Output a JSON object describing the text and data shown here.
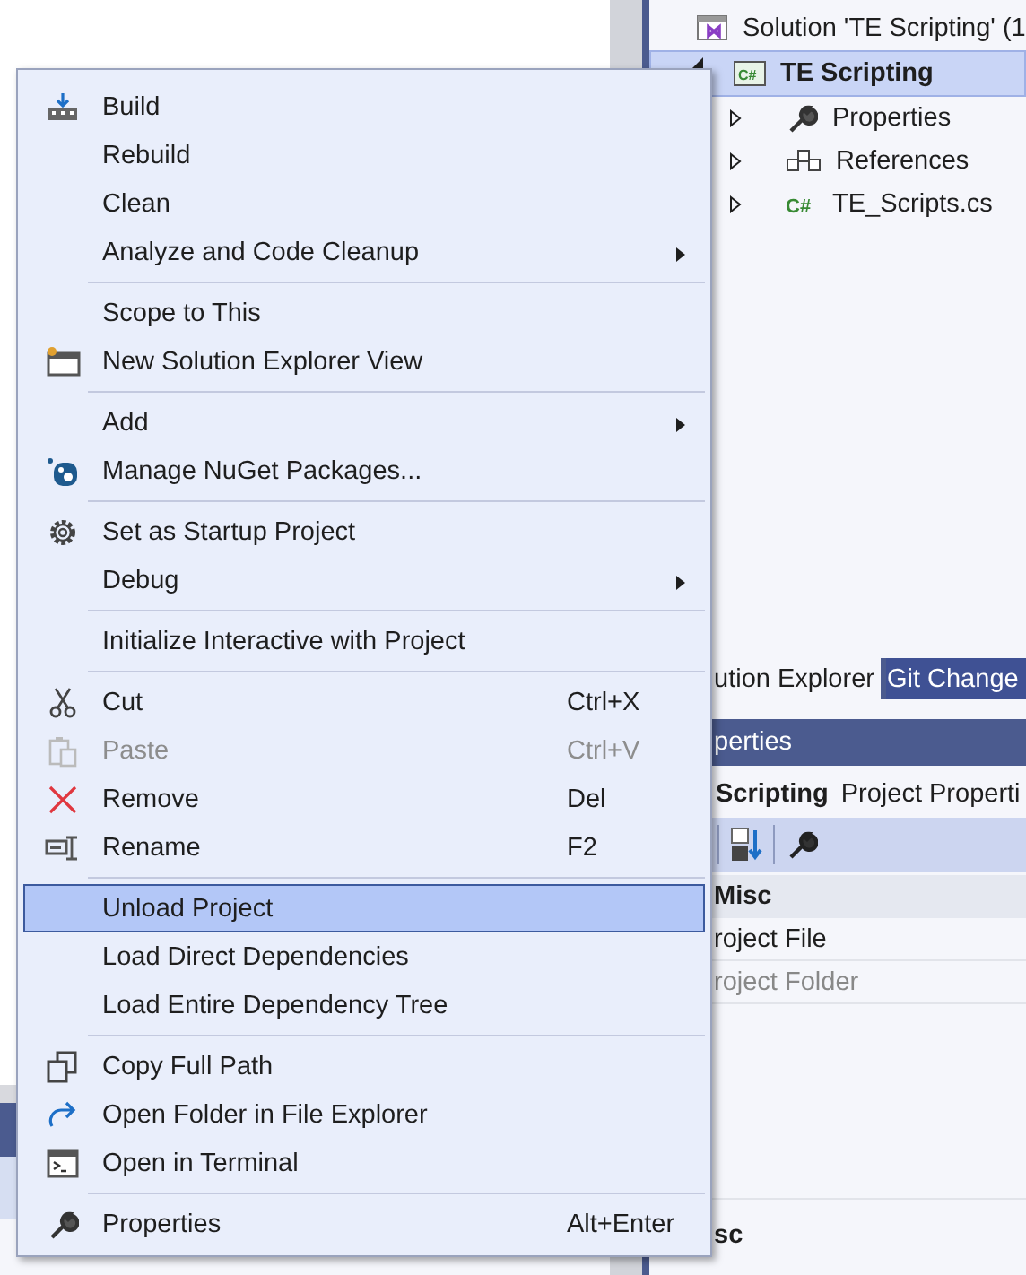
{
  "solution_explorer": {
    "solution": "Solution 'TE Scripting' (1",
    "project": {
      "label": "TE Scripting",
      "icon_text": "C#",
      "expanded": true,
      "selected": true
    },
    "children": [
      {
        "label": "Properties",
        "expanded": false
      },
      {
        "label": "References",
        "expanded": false
      },
      {
        "label": "TE_Scripts.cs",
        "icon_text": "C#",
        "expanded": false
      }
    ]
  },
  "tabs": [
    {
      "label": "ution Explorer",
      "selected": true
    },
    {
      "label": "Git Change",
      "selected": false
    }
  ],
  "properties": {
    "title": "perties",
    "object_name": "Scripting",
    "object_type": "Project Properti",
    "category": "Misc",
    "rows": [
      {
        "label": "roject File",
        "disabled": false
      },
      {
        "label": "roject Folder",
        "disabled": true
      }
    ],
    "description_title": "sc"
  },
  "context_menu": {
    "items": [
      {
        "kind": "command",
        "label": "Build",
        "disabled": false,
        "selected": false,
        "submenu": false
      },
      {
        "kind": "command",
        "label": "Rebuild",
        "disabled": false,
        "selected": false,
        "submenu": false
      },
      {
        "kind": "command",
        "label": "Clean",
        "disabled": false,
        "selected": false,
        "submenu": false
      },
      {
        "kind": "command",
        "label": "Analyze and Code Cleanup",
        "disabled": false,
        "selected": false,
        "submenu": true
      },
      {
        "kind": "separator"
      },
      {
        "kind": "command",
        "label": "Scope to This",
        "disabled": false,
        "selected": false,
        "submenu": false
      },
      {
        "kind": "command",
        "label": "New Solution Explorer View",
        "disabled": false,
        "selected": false,
        "submenu": false
      },
      {
        "kind": "separator"
      },
      {
        "kind": "command",
        "label": "Add",
        "disabled": false,
        "selected": false,
        "submenu": true
      },
      {
        "kind": "command",
        "label": "Manage NuGet Packages...",
        "disabled": false,
        "selected": false,
        "submenu": false
      },
      {
        "kind": "separator"
      },
      {
        "kind": "command",
        "label": "Set as Startup Project",
        "disabled": false,
        "selected": false,
        "submenu": false
      },
      {
        "kind": "command",
        "label": "Debug",
        "disabled": false,
        "selected": false,
        "submenu": true
      },
      {
        "kind": "separator"
      },
      {
        "kind": "command",
        "label": "Initialize Interactive with Project",
        "disabled": false,
        "selected": false,
        "submenu": false
      },
      {
        "kind": "separator"
      },
      {
        "kind": "command",
        "label": "Cut",
        "shortcut": "Ctrl+X",
        "disabled": false,
        "selected": false,
        "submenu": false
      },
      {
        "kind": "command",
        "label": "Paste",
        "shortcut": "Ctrl+V",
        "disabled": true,
        "selected": false,
        "submenu": false
      },
      {
        "kind": "command",
        "label": "Remove",
        "shortcut": "Del",
        "disabled": false,
        "selected": false,
        "submenu": false
      },
      {
        "kind": "command",
        "label": "Rename",
        "shortcut": "F2",
        "disabled": false,
        "selected": false,
        "submenu": false
      },
      {
        "kind": "separator"
      },
      {
        "kind": "command",
        "label": "Unload Project",
        "disabled": false,
        "selected": true,
        "submenu": false
      },
      {
        "kind": "command",
        "label": "Load Direct Dependencies",
        "disabled": false,
        "selected": false,
        "submenu": false
      },
      {
        "kind": "command",
        "label": "Load Entire Dependency Tree",
        "disabled": false,
        "selected": false,
        "submenu": false
      },
      {
        "kind": "separator"
      },
      {
        "kind": "command",
        "label": "Copy Full Path",
        "disabled": false,
        "selected": false,
        "submenu": false
      },
      {
        "kind": "command",
        "label": "Open Folder in File Explorer",
        "disabled": false,
        "selected": false,
        "submenu": false
      },
      {
        "kind": "command",
        "label": "Open in Terminal",
        "disabled": false,
        "selected": false,
        "submenu": false
      },
      {
        "kind": "separator"
      },
      {
        "kind": "command",
        "label": "Properties",
        "shortcut": "Alt+Enter",
        "disabled": false,
        "selected": false,
        "submenu": false
      }
    ]
  }
}
